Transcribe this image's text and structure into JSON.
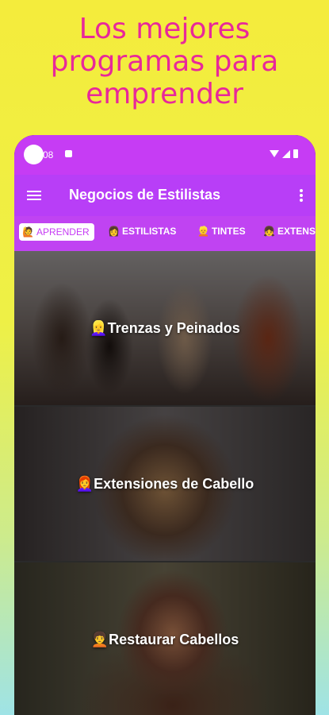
{
  "promo": {
    "headline": "Los mejores\nprogramas para\nemprender"
  },
  "status_bar": {
    "time": "08",
    "icons": [
      "wifi-icon",
      "signal-icon",
      "battery-icon"
    ]
  },
  "app_bar": {
    "title": "Negocios de Estilistas",
    "menu_icon": "hamburger-menu-icon",
    "overflow_icon": "more-vertical-icon"
  },
  "tabs": [
    {
      "emoji": "🙋",
      "label": "APRENDER",
      "active": true
    },
    {
      "emoji": "👩",
      "label": "ESTILISTAS",
      "active": false
    },
    {
      "emoji": "👱",
      "label": "TINTES",
      "active": false
    },
    {
      "emoji": "👧",
      "label": "EXTENS",
      "active": false
    }
  ],
  "cards": [
    {
      "emoji": "👱‍♀️",
      "label": "Trenzas y Peinados"
    },
    {
      "emoji": "👩‍🦰",
      "label": "Extensiones de Cabello"
    },
    {
      "emoji": "🧑‍🦱",
      "label": "Restaurar Cabellos"
    }
  ],
  "colors": {
    "accent": "#c63cf4",
    "promo_text": "#e8289a"
  }
}
